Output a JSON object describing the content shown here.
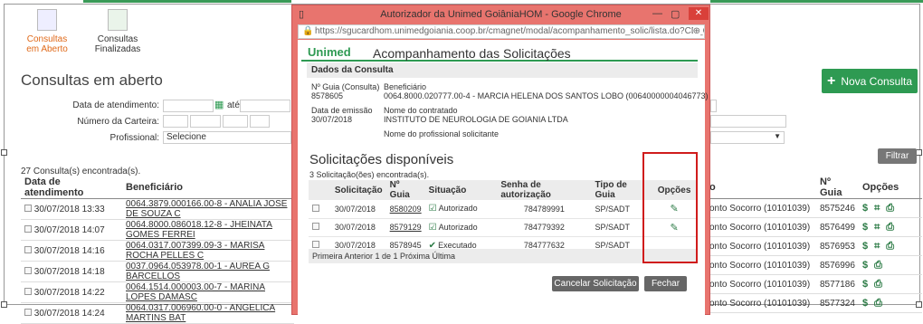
{
  "nav": [
    {
      "label": "Consultas em Aberto",
      "active": true,
      "icon": "document-list-icon"
    },
    {
      "label": "Consultas Finalizadas",
      "active": false,
      "icon": "checklist-icon"
    }
  ],
  "page_title": "Consultas em aberto",
  "filters": {
    "data_label": "Data de atendimento:",
    "ate": "até",
    "carteira_label": "Número da Carteira:",
    "prof_label": "Profissional:",
    "prof_value": "Selecione"
  },
  "buttons": {
    "nova": "Nova Consulta",
    "filtrar": "Filtrar"
  },
  "found": "27 Consulta(s) encontrada(s).",
  "list_headers": [
    "Data de atendimento",
    "Beneficiário"
  ],
  "list_rows": [
    {
      "date": "30/07/2018 13:33",
      "benef": "0064.3879.000166.00-8 - ANALIA JOSE DE SOUZA C"
    },
    {
      "date": "30/07/2018 14:07",
      "benef": "0064.8000.086018.12-8 - JHEINATA GOMES FERREI"
    },
    {
      "date": "30/07/2018 14:16",
      "benef": "0064.0317.007399.09-3 - MARISA ROCHA PELLES C"
    },
    {
      "date": "30/07/2018 14:18",
      "benef": "0037.0964.053978.00-1 - AUREA G BARCELLOS"
    },
    {
      "date": "30/07/2018 14:22",
      "benef": "0064.1514.000003.00-7 - MARINA LOPES DAMASC"
    },
    {
      "date": "30/07/2018 14:24",
      "benef": "0064.0317.006960.00-0 - ANGELICA MARTINS BAT"
    }
  ],
  "right_headers": [
    "o",
    "Nº Guia",
    "Opções"
  ],
  "right_rows": [
    {
      "local": "onto Socorro (10101039)",
      "guia": "8575246",
      "opts": [
        "$",
        "binoculars",
        "print"
      ]
    },
    {
      "local": "onto Socorro (10101039)",
      "guia": "8576499",
      "opts": [
        "$",
        "binoculars",
        "print"
      ]
    },
    {
      "local": "onto Socorro (10101039)",
      "guia": "8576953",
      "opts": [
        "$",
        "binoculars",
        "print"
      ]
    },
    {
      "local": "onto Socorro (10101039)",
      "guia": "8576996",
      "opts": [
        "$",
        "print"
      ]
    },
    {
      "local": "onto Socorro (10101039)",
      "guia": "8577186",
      "opts": [
        "$",
        "print"
      ]
    },
    {
      "local": "onto Socorro (10101039)",
      "guia": "8577324",
      "opts": [
        "$",
        "print"
      ]
    }
  ],
  "modal": {
    "window_title": "Autorizador da Unimed GoiâniaHOM - Google Chrome",
    "url": "https://sgucardhom.unimedgoiania.coop.br/cmagnet/modal/acompanhamento_solic/lista.do?CD_C...",
    "logo": "Unimed",
    "title": "Acompanhamento das Solicitações",
    "section": "Dados da Consulta",
    "guia_label": "Nº Guia (Consulta)",
    "guia_value": "8578605",
    "benef_label": "Beneficiário",
    "benef_value": "0064.8000.020777.00-4 - MARCIA HELENA DOS SANTOS LOBO (00640000004046773)",
    "emissao_label": "Data de emissão",
    "emissao_value": "30/07/2018",
    "contratado_label": "Nome do contratado",
    "contratado_value": "INSTITUTO DE NEUROLOGIA DE GOIANIA LTDA",
    "solicitante_label": "Nome do profissional solicitante",
    "sol_title": "Solicitações disponíveis",
    "sol_count": "3 Solicitação(ões) encontrada(s).",
    "sol_headers": [
      "",
      "Solicitação",
      "Nº Guia",
      "Situação",
      "Senha de autorização",
      "Tipo de Guia",
      "Opções"
    ],
    "sol_rows": [
      {
        "data": "30/07/2018",
        "guia": "8580209",
        "sit": "Autorizado",
        "senha": "784789991",
        "tipo": "SP/SADT",
        "edit": true
      },
      {
        "data": "30/07/2018",
        "guia": "8579129",
        "sit": "Autorizado",
        "senha": "784779392",
        "tipo": "SP/SADT",
        "edit": true
      },
      {
        "data": "30/07/2018",
        "guia": "8578945",
        "sit": "Executado",
        "senha": "784777632",
        "tipo": "SP/SADT",
        "edit": false
      }
    ],
    "pager": "Primeira Anterior   1 de 1   Próxima Última",
    "cancel": "Cancelar Solicitação",
    "close": "Fechar"
  }
}
